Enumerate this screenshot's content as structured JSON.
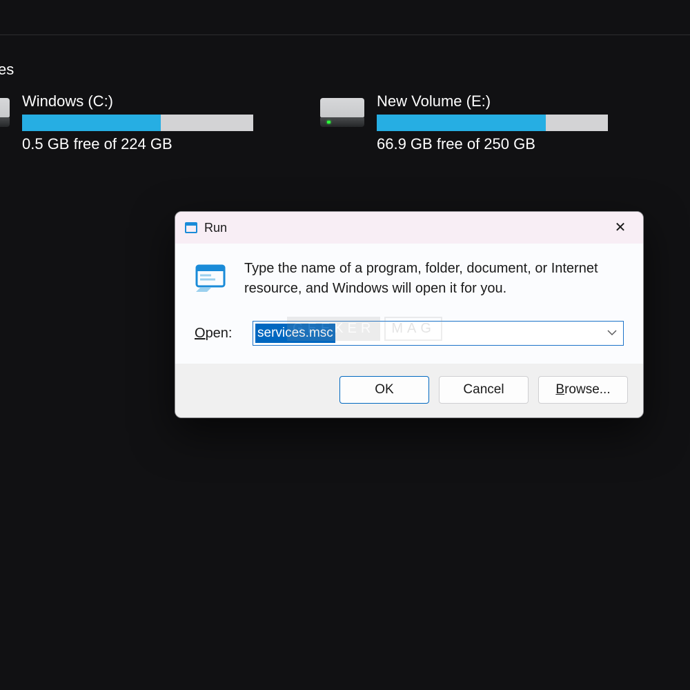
{
  "section_heading": "ves",
  "drives": [
    {
      "name": "Windows (C:)",
      "stats": "0.5 GB free of 224 GB",
      "fill_pct": 60
    },
    {
      "name": "New Volume (E:)",
      "stats": "66.9 GB free of 250 GB",
      "fill_pct": 73
    }
  ],
  "run_dialog": {
    "title": "Run",
    "description": "Type the name of a program, folder, document, or Internet resource, and Windows will open it for you.",
    "open_label": "Open:",
    "input_value": "services.msc",
    "buttons": {
      "ok": "OK",
      "cancel": "Cancel",
      "browse": "Browse..."
    }
  },
  "watermark": {
    "part1": "GEEKER",
    "part2": "MAG"
  }
}
